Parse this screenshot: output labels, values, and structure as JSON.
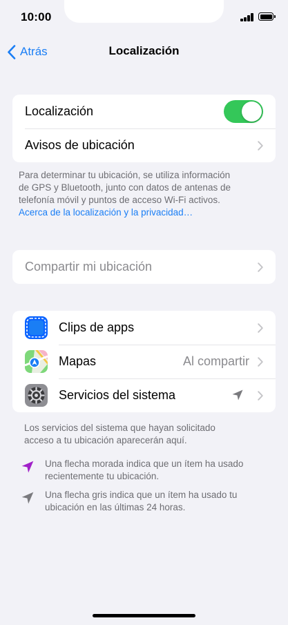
{
  "status_bar": {
    "time": "10:00"
  },
  "nav": {
    "back_label": "Atrás",
    "title": "Localización"
  },
  "group1": {
    "location_label": "Localización",
    "location_on": true,
    "alerts_label": "Avisos de ubicación"
  },
  "footnote1": {
    "lines": [
      "Para determinar tu ubicación, se utiliza información",
      "de GPS y Bluetooth, junto con datos de antenas de",
      "telefonía móvil y puntos de acceso Wi-Fi activos."
    ],
    "link": "Acerca de la localización y la privacidad…"
  },
  "group2": {
    "share_label": "Compartir mi ubicación"
  },
  "group3": {
    "items": [
      {
        "label": "Clips de apps",
        "value": "",
        "icon": "app-clips-icon"
      },
      {
        "label": "Mapas",
        "value": "Al compartir",
        "icon": "maps-icon"
      },
      {
        "label": "Servicios del sistema",
        "value": "",
        "icon": "gear-icon"
      }
    ]
  },
  "footnote2": {
    "lines": [
      "Los servicios del sistema que hayan solicitado",
      "acceso a tu ubicación aparecerán aquí."
    ]
  },
  "legend": {
    "purple": {
      "lines": [
        "Una flecha morada indica que un ítem ha usado",
        "recientemente tu ubicación."
      ],
      "color": "#a020c8"
    },
    "gray": {
      "lines": [
        "Una flecha gris indica que un ítem ha usado tu",
        "ubicación en las últimas 24 horas."
      ],
      "color": "#7a7a7e"
    }
  },
  "colors": {
    "accent": "#1a7ef5",
    "toggle_on": "#34c759",
    "background": "#f2f2f7"
  }
}
